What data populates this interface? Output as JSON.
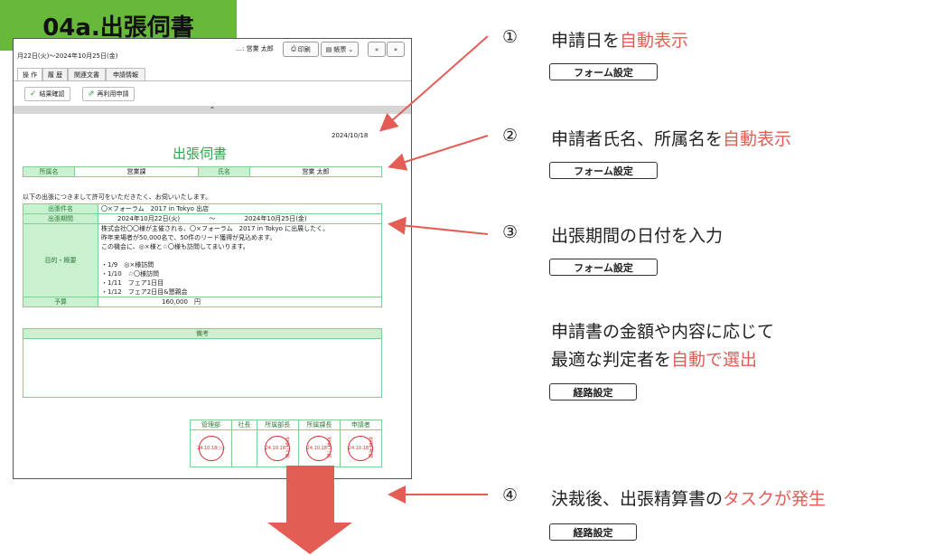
{
  "badge": {
    "title": "04a.出張伺書"
  },
  "screen": {
    "date_range": "月22日(火)〜2024年10月25日(金)",
    "user": "…: 営業 太郎",
    "print_label": "印刷",
    "form_label": "帳票",
    "nav_prev": "«",
    "nav_next": "»",
    "tabs": [
      "操 作",
      "履 歴",
      "関連文書",
      "申請情報"
    ],
    "actions": {
      "confirm": "結果確認",
      "reapply": "再利用申請"
    },
    "collapse_icon": "⌃",
    "doc": {
      "date": "2024/10/18",
      "title": "出張伺書",
      "dept_label": "所属名",
      "dept_value": "営業課",
      "name_label": "氏名",
      "name_value": "営業 太郎",
      "intro": "以下の出張につきまして許可をいただきたく、お伺いいたします。",
      "subject_label": "出張件名",
      "subject_value": "〇×フォーラム　2017 in Tokyo 出店",
      "period_label": "出張期間",
      "period_start": "2024年10月22日(火)",
      "period_sep": "〜",
      "period_end": "2024年10月25日(金)",
      "purpose_label": "目的・概要",
      "purpose_lines": [
        "株式会社〇〇様が主催される、〇×フォーラム　2017 in Tokyo に出展したく。",
        "昨年来場者が50,000名で、50件のリード獲得が見込めます。",
        "この機会に、◎×様と☆〇様も訪問してまいります。",
        "",
        "・1/9　◎×様訪問",
        "・1/10　☆〇様訪問",
        "・1/11　フェア1日目",
        "・1/12　フェア2日目&懇親会"
      ],
      "budget_label": "予算",
      "budget_value": "160,000　円",
      "remarks_label": "備考",
      "approvers": [
        "管理部",
        "社長",
        "所属部長",
        "所属課長",
        "申請者"
      ],
      "stamps": [
        {
          "date": "24.10.18",
          "name": "○○"
        },
        {
          "date": "",
          "name": ""
        },
        {
          "date": "24.10.18",
          "name": "営業 三郎"
        },
        {
          "date": "24.10.18",
          "name": "営業 二郎"
        },
        {
          "date": "24.10.18",
          "name": "営業 太郎"
        }
      ]
    }
  },
  "annotations": [
    {
      "num": "①",
      "text": "申請日を",
      "highlight": "自動表示",
      "tail": "",
      "tag": "フォーム設定"
    },
    {
      "num": "②",
      "text": "申請者氏名、所属名を",
      "highlight": "自動表示",
      "tail": "",
      "tag": "フォーム設定"
    },
    {
      "num": "③",
      "text": "出張期間の日付を入力",
      "highlight": "",
      "tail": "",
      "tag": "フォーム設定"
    },
    {
      "num": "",
      "text": "申請書の金額や内容に応じて",
      "line2": "最適な判定者を",
      "highlight": "自動で選出",
      "tail": "",
      "tag": "経路設定"
    },
    {
      "num": "④",
      "text": "決裁後、出張精算書の",
      "highlight": "タスクが発生",
      "tail": "",
      "tag": "経路設定"
    }
  ],
  "colors": {
    "badge": "#68b83a",
    "arrow": "#e35d55",
    "form_green": "#2aa34a",
    "label_bg": "#c9f0cf"
  }
}
